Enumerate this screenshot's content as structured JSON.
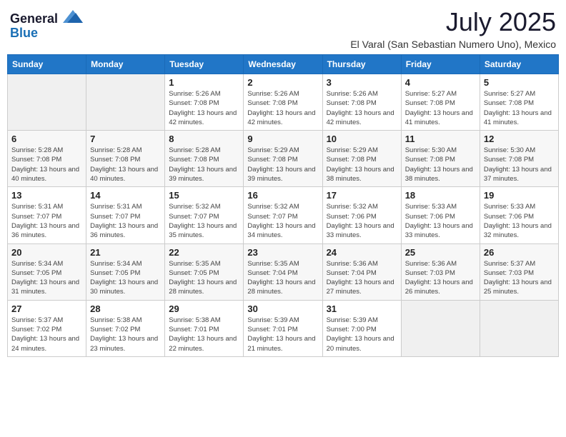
{
  "logo": {
    "general": "General",
    "blue": "Blue"
  },
  "title": "July 2025",
  "location": "El Varal (San Sebastian Numero Uno), Mexico",
  "days_of_week": [
    "Sunday",
    "Monday",
    "Tuesday",
    "Wednesday",
    "Thursday",
    "Friday",
    "Saturday"
  ],
  "weeks": [
    [
      {
        "day": "",
        "detail": ""
      },
      {
        "day": "",
        "detail": ""
      },
      {
        "day": "1",
        "detail": "Sunrise: 5:26 AM\nSunset: 7:08 PM\nDaylight: 13 hours and 42 minutes."
      },
      {
        "day": "2",
        "detail": "Sunrise: 5:26 AM\nSunset: 7:08 PM\nDaylight: 13 hours and 42 minutes."
      },
      {
        "day": "3",
        "detail": "Sunrise: 5:26 AM\nSunset: 7:08 PM\nDaylight: 13 hours and 42 minutes."
      },
      {
        "day": "4",
        "detail": "Sunrise: 5:27 AM\nSunset: 7:08 PM\nDaylight: 13 hours and 41 minutes."
      },
      {
        "day": "5",
        "detail": "Sunrise: 5:27 AM\nSunset: 7:08 PM\nDaylight: 13 hours and 41 minutes."
      }
    ],
    [
      {
        "day": "6",
        "detail": "Sunrise: 5:28 AM\nSunset: 7:08 PM\nDaylight: 13 hours and 40 minutes."
      },
      {
        "day": "7",
        "detail": "Sunrise: 5:28 AM\nSunset: 7:08 PM\nDaylight: 13 hours and 40 minutes."
      },
      {
        "day": "8",
        "detail": "Sunrise: 5:28 AM\nSunset: 7:08 PM\nDaylight: 13 hours and 39 minutes."
      },
      {
        "day": "9",
        "detail": "Sunrise: 5:29 AM\nSunset: 7:08 PM\nDaylight: 13 hours and 39 minutes."
      },
      {
        "day": "10",
        "detail": "Sunrise: 5:29 AM\nSunset: 7:08 PM\nDaylight: 13 hours and 38 minutes."
      },
      {
        "day": "11",
        "detail": "Sunrise: 5:30 AM\nSunset: 7:08 PM\nDaylight: 13 hours and 38 minutes."
      },
      {
        "day": "12",
        "detail": "Sunrise: 5:30 AM\nSunset: 7:08 PM\nDaylight: 13 hours and 37 minutes."
      }
    ],
    [
      {
        "day": "13",
        "detail": "Sunrise: 5:31 AM\nSunset: 7:07 PM\nDaylight: 13 hours and 36 minutes."
      },
      {
        "day": "14",
        "detail": "Sunrise: 5:31 AM\nSunset: 7:07 PM\nDaylight: 13 hours and 36 minutes."
      },
      {
        "day": "15",
        "detail": "Sunrise: 5:32 AM\nSunset: 7:07 PM\nDaylight: 13 hours and 35 minutes."
      },
      {
        "day": "16",
        "detail": "Sunrise: 5:32 AM\nSunset: 7:07 PM\nDaylight: 13 hours and 34 minutes."
      },
      {
        "day": "17",
        "detail": "Sunrise: 5:32 AM\nSunset: 7:06 PM\nDaylight: 13 hours and 33 minutes."
      },
      {
        "day": "18",
        "detail": "Sunrise: 5:33 AM\nSunset: 7:06 PM\nDaylight: 13 hours and 33 minutes."
      },
      {
        "day": "19",
        "detail": "Sunrise: 5:33 AM\nSunset: 7:06 PM\nDaylight: 13 hours and 32 minutes."
      }
    ],
    [
      {
        "day": "20",
        "detail": "Sunrise: 5:34 AM\nSunset: 7:05 PM\nDaylight: 13 hours and 31 minutes."
      },
      {
        "day": "21",
        "detail": "Sunrise: 5:34 AM\nSunset: 7:05 PM\nDaylight: 13 hours and 30 minutes."
      },
      {
        "day": "22",
        "detail": "Sunrise: 5:35 AM\nSunset: 7:05 PM\nDaylight: 13 hours and 28 minutes."
      },
      {
        "day": "23",
        "detail": "Sunrise: 5:35 AM\nSunset: 7:04 PM\nDaylight: 13 hours and 28 minutes."
      },
      {
        "day": "24",
        "detail": "Sunrise: 5:36 AM\nSunset: 7:04 PM\nDaylight: 13 hours and 27 minutes."
      },
      {
        "day": "25",
        "detail": "Sunrise: 5:36 AM\nSunset: 7:03 PM\nDaylight: 13 hours and 26 minutes."
      },
      {
        "day": "26",
        "detail": "Sunrise: 5:37 AM\nSunset: 7:03 PM\nDaylight: 13 hours and 25 minutes."
      }
    ],
    [
      {
        "day": "27",
        "detail": "Sunrise: 5:37 AM\nSunset: 7:02 PM\nDaylight: 13 hours and 24 minutes."
      },
      {
        "day": "28",
        "detail": "Sunrise: 5:38 AM\nSunset: 7:02 PM\nDaylight: 13 hours and 23 minutes."
      },
      {
        "day": "29",
        "detail": "Sunrise: 5:38 AM\nSunset: 7:01 PM\nDaylight: 13 hours and 22 minutes."
      },
      {
        "day": "30",
        "detail": "Sunrise: 5:39 AM\nSunset: 7:01 PM\nDaylight: 13 hours and 21 minutes."
      },
      {
        "day": "31",
        "detail": "Sunrise: 5:39 AM\nSunset: 7:00 PM\nDaylight: 13 hours and 20 minutes."
      },
      {
        "day": "",
        "detail": ""
      },
      {
        "day": "",
        "detail": ""
      }
    ]
  ]
}
